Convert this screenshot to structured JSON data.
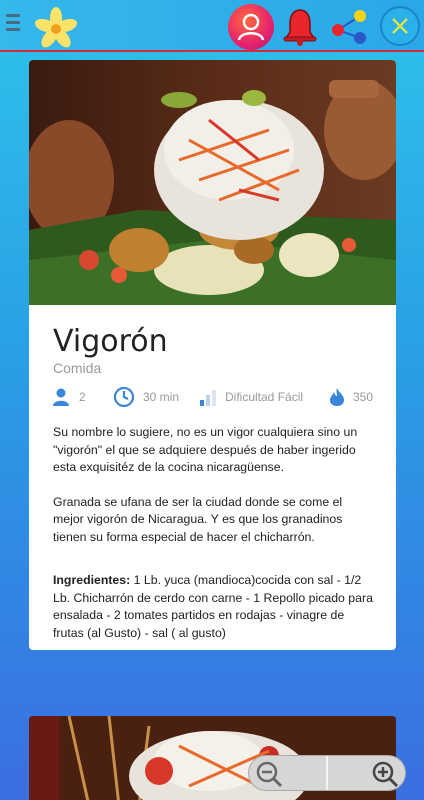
{
  "header": {
    "menu_icon": "hamburger-menu-icon",
    "logo_icon": "flower-logo-icon",
    "profile_icon": "user-profile-icon",
    "notifications_icon": "bell-icon",
    "share_icon": "share-icon",
    "close_icon": "close-icon",
    "accent_color": "#d9283c"
  },
  "recipe": {
    "title": "Vigorón",
    "category": "Comida",
    "servings": "2",
    "time": "30 min",
    "difficulty": "Dificultad Fácil",
    "calories": "350",
    "paragraph1": "Su nombre lo sugiere, no es un vigor cualquiera sino un \"vigorón\" el que se adquiere después de haber ingerido esta exquisitéz de la cocina nicaragüense.",
    "paragraph2": "Granada se ufana de ser la ciudad donde se come el mejor vigorón de Nicaragua. Y es que los granadinos tienen su forma especial de hacer el chicharrón.",
    "ingredients_label": "Ingredientes:",
    "ingredients_text": " 1 Lb. yuca (mandioca)cocida con sal - 1/2 Lb. Chicharrón de cerdo con carne - 1 Repollo picado para ensalada - 2 tomates partidos en rodajas - vinagre de frutas (al Gusto) - sal ( al gusto)"
  },
  "zoom": {
    "zoom_out_icon": "zoom-out-icon",
    "zoom_in_icon": "zoom-in-icon"
  }
}
